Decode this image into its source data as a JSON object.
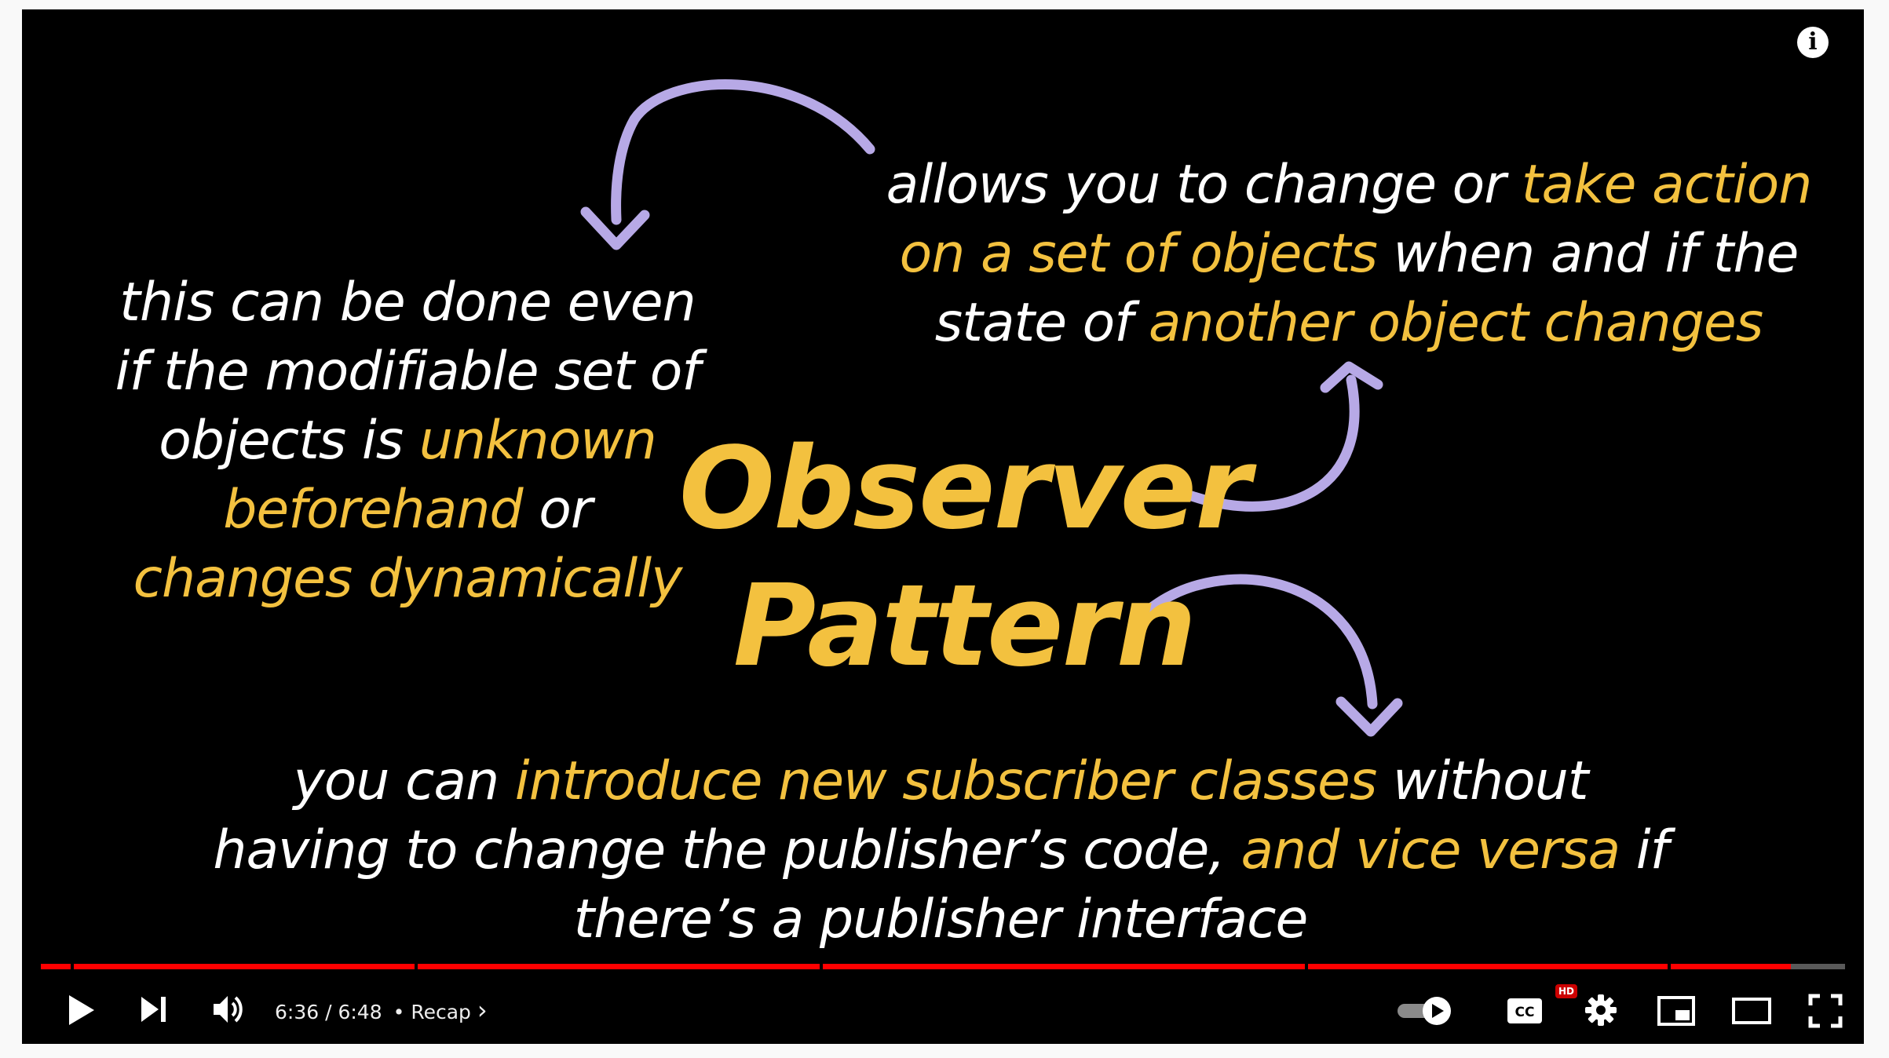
{
  "slide": {
    "title_line1": "Observer",
    "title_line2": "Pattern",
    "top_right": {
      "l1a": "allows you to change or ",
      "l1b": "take action",
      "l2a": "on a set of objects",
      "l2b": " when and if the",
      "l3a": "state of ",
      "l3b": "another object changes"
    },
    "left": {
      "l1": "this can be done even",
      "l2": "if the modifiable set of",
      "l3a": "objects is ",
      "l3b": "unknown",
      "l4a": "beforehand",
      "l4b": " or",
      "l5": "changes dynamically"
    },
    "bottom": {
      "l1a": "you can ",
      "l1b": "introduce new subscriber classes",
      "l1c": " without",
      "l2a": "having to change the publisher’s code, ",
      "l2b": "and vice versa",
      "l2c": " if",
      "l3": "there’s a publisher interface"
    },
    "colors": {
      "background": "#000000",
      "text": "#ffffff",
      "highlight": "#f3c13f",
      "arrow": "#b7a9e6"
    }
  },
  "player": {
    "info_icon": "info-icon",
    "info_glyph": "i",
    "current_time": "6:36",
    "time_separator": " / ",
    "duration": "6:48",
    "chapter_separator": "•",
    "chapter": "Recap",
    "chapter_arrow": "›",
    "progress_fraction": 0.97,
    "hd_badge": "HD",
    "autoplay": true,
    "colors": {
      "progress": "#ff0000",
      "controls": "#ffffff"
    },
    "icons": [
      "play-icon",
      "next-icon",
      "volume-icon",
      "autoplay-toggle-icon",
      "captions-icon",
      "settings-icon",
      "miniplayer-icon",
      "theater-icon",
      "fullscreen-icon"
    ]
  }
}
